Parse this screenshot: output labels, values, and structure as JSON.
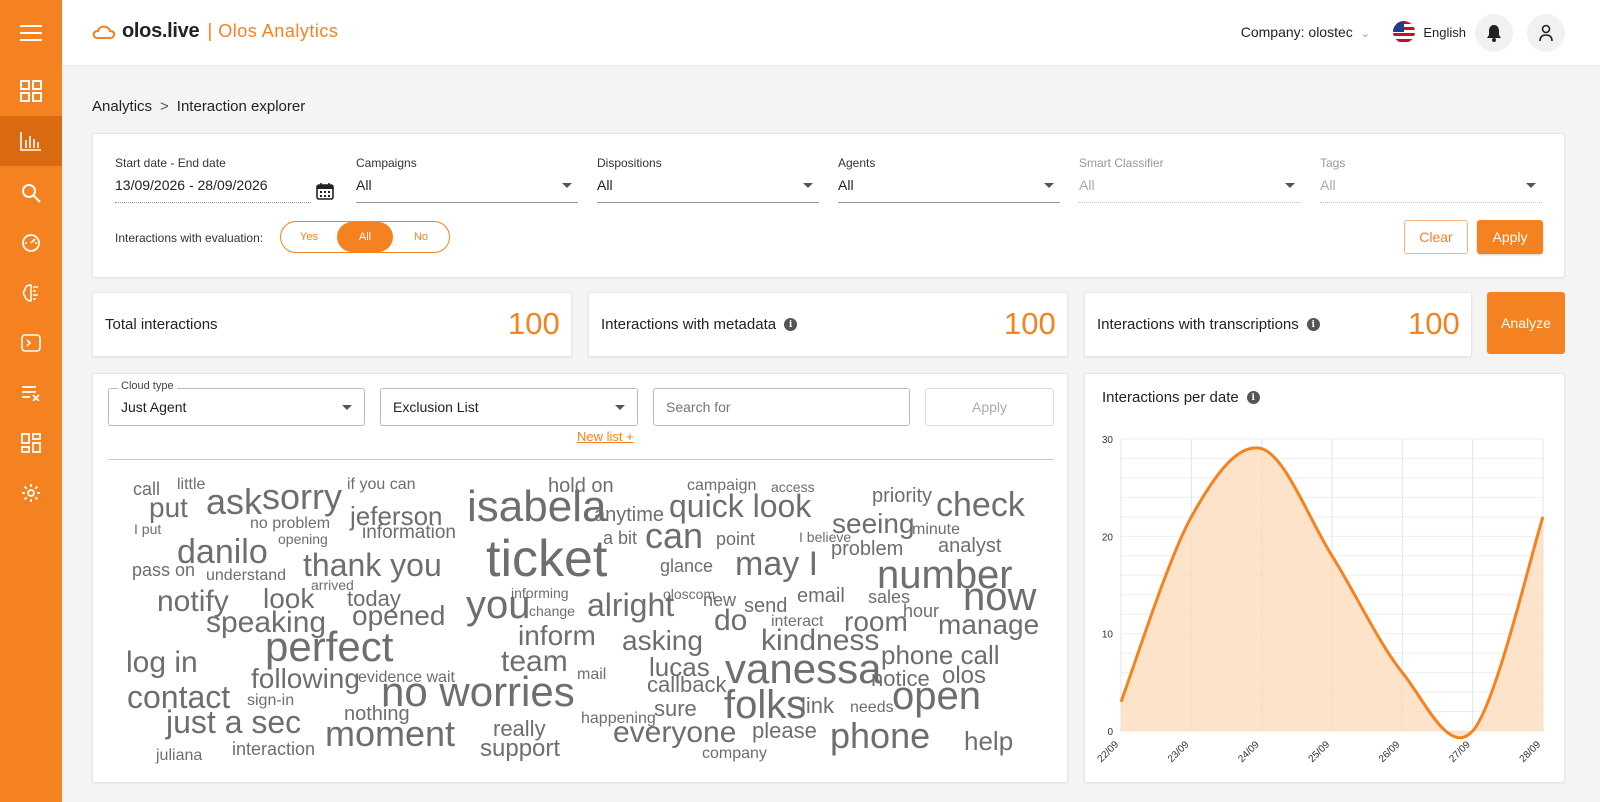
{
  "app": {
    "brand": "olos.live",
    "separator": "|",
    "product": "Olos Analytics"
  },
  "header": {
    "company": "Company: olostec",
    "language": "English"
  },
  "sidebar_icons": [
    "menu-icon",
    "dashboard-icon",
    "analytics-icon",
    "search-icon",
    "speedometer-icon",
    "brain-icon",
    "terminal-icon",
    "list-remove-icon",
    "widgets-icon",
    "settings-icon"
  ],
  "breadcrumb": {
    "root": "Analytics",
    "sep": ">",
    "current": "Interaction explorer"
  },
  "filters": {
    "date": {
      "label": "Start date - End date",
      "value": "13/09/2026 - 28/09/2026"
    },
    "campaigns": {
      "label": "Campaigns",
      "value": "All"
    },
    "dispositions": {
      "label": "Dispositions",
      "value": "All"
    },
    "agents": {
      "label": "Agents",
      "value": "All"
    },
    "smart_classifier": {
      "label": "Smart Classifier",
      "value": "All"
    },
    "tags": {
      "label": "Tags",
      "value": "All"
    },
    "evaluation": {
      "label": "Interactions with evaluation:",
      "yes": "Yes",
      "all": "All",
      "no": "No"
    },
    "clear": "Clear",
    "apply": "Apply"
  },
  "stats": {
    "total": {
      "label": "Total interactions",
      "value": "100"
    },
    "metadata": {
      "label": "Interactions with metadata",
      "value": "100"
    },
    "transcriptions": {
      "label": "Interactions with transcriptions",
      "value": "100"
    },
    "analyze": "Analyze"
  },
  "cloud": {
    "type_label": "Cloud type",
    "type_value": "Just Agent",
    "exclusion": "Exclusion List",
    "search_placeholder": "Search for",
    "apply": "Apply",
    "new_list": "New list +",
    "words": [
      "call",
      "little",
      "if you can",
      "hold on",
      "campaign",
      "access",
      "priority",
      "put",
      "ask",
      "sorry",
      "isabela",
      "anytime",
      "quick look",
      "check",
      "seeing",
      "jeferson",
      "minute",
      "I put",
      "no problem",
      "information",
      "opening",
      "a bit",
      "can",
      "point",
      "I believe",
      "analyst",
      "danilo",
      "problem",
      "ticket",
      "glance",
      "may I",
      "thank you",
      "pass on",
      "understand",
      "number",
      "arrived",
      "today",
      "informing",
      "oloscom",
      "email",
      "sales",
      "now",
      "notify",
      "look",
      "new",
      "send",
      "you",
      "alright",
      "change",
      "hour",
      "speaking",
      "opened",
      "do",
      "room",
      "manage",
      "interact",
      "inform",
      "asking",
      "kindness",
      "perfect",
      "log in",
      "phone call",
      "team",
      "lucas",
      "vanessa",
      "notice",
      "olos",
      "following",
      "evidence wait",
      "mail",
      "callback",
      "contact",
      "no worries",
      "sign-in",
      "folks",
      "link",
      "needs",
      "open",
      "sure",
      "nothing",
      "happening",
      "just a sec",
      "moment",
      "really",
      "please",
      "everyone",
      "phone",
      "help",
      "support",
      "juliana",
      "interaction",
      "company"
    ]
  },
  "chart_data": {
    "type": "area",
    "title": "Interactions per date",
    "xlabel": "",
    "ylabel": "",
    "categories": [
      "22/09",
      "23/09",
      "24/09",
      "25/09",
      "26/09",
      "27/09",
      "28/09"
    ],
    "values": [
      3,
      22,
      29,
      18,
      6,
      0,
      22
    ],
    "ylim": [
      0,
      30
    ],
    "yticks": [
      0,
      10,
      20,
      30
    ],
    "smooth": true,
    "grid": true,
    "color": "#f58220",
    "fill": "#fbdcbd"
  },
  "colors": {
    "accent": "#f58220",
    "accent_dark": "#d96a10",
    "word": "#6e6e6e"
  }
}
